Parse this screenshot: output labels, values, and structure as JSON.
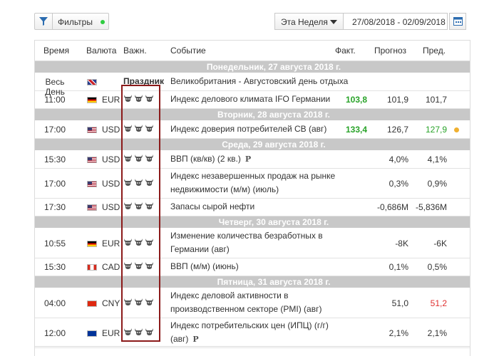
{
  "toolbar": {
    "filter_label": "Фильтры",
    "filter_dot_color": "#2ecc40",
    "week_label": "Эта Неделя",
    "date_range": "27/08/2018 - 02/09/2018"
  },
  "header": {
    "time": "Время",
    "currency": "Валюта",
    "importance": "Важн.",
    "event": "Событие",
    "actual": "Факт.",
    "forecast": "Прогноз",
    "previous": "Пред."
  },
  "days": [
    {
      "title": "Понедельник, 27 августа 2018 г.",
      "rows": [
        {
          "time": "Весь День",
          "flag": "gb",
          "currency": "",
          "importance_text": "Праздник",
          "bulls": 0,
          "event": "Великобритания - Августовский день отдыха",
          "event2": "",
          "actual": "",
          "actual_color": "",
          "forecast": "",
          "previous": "",
          "previous_color": "",
          "dot": "",
          "p": ""
        }
      ]
    },
    {
      "title": "",
      "rows": [
        {
          "time": "11:00",
          "flag": "de",
          "currency": "EUR",
          "importance_text": "",
          "bulls": 3,
          "event": "Индекс делового климата IFO Германии",
          "event2": "",
          "actual": "103,8",
          "actual_color": "green",
          "forecast": "101,9",
          "previous": "101,7",
          "previous_color": "",
          "dot": "",
          "p": ""
        }
      ]
    },
    {
      "title": "Вторник, 28 августа 2018 г.",
      "rows": [
        {
          "time": "17:00",
          "flag": "us",
          "currency": "USD",
          "importance_text": "",
          "bulls": 3,
          "event": "Индекс доверия потребителей CB (авг)",
          "event2": "",
          "actual": "133,4",
          "actual_color": "green",
          "forecast": "126,7",
          "previous": "127,9",
          "previous_color": "green",
          "dot": "#f0b030",
          "p": ""
        }
      ]
    },
    {
      "title": "Среда, 29 августа 2018 г.",
      "rows": [
        {
          "time": "15:30",
          "flag": "us",
          "currency": "USD",
          "importance_text": "",
          "bulls": 3,
          "event": "ВВП (кв/кв) (2 кв.)",
          "event2": "",
          "actual": "",
          "actual_color": "",
          "forecast": "4,0%",
          "previous": "4,1%",
          "previous_color": "",
          "dot": "",
          "p": "P"
        },
        {
          "time": "17:00",
          "flag": "us",
          "currency": "USD",
          "importance_text": "",
          "bulls": 3,
          "event": "Индекс незавершенных продаж на рынке",
          "event2": "недвижимости (м/м) (июль)",
          "actual": "",
          "actual_color": "",
          "forecast": "0,3%",
          "previous": "0,9%",
          "previous_color": "",
          "dot": "",
          "p": ""
        },
        {
          "time": "17:30",
          "flag": "us",
          "currency": "USD",
          "importance_text": "",
          "bulls": 3,
          "event": "Запасы сырой нефти",
          "event2": "",
          "actual": "",
          "actual_color": "",
          "forecast": "-0,686M",
          "previous": "-5,836M",
          "previous_color": "",
          "dot": "",
          "p": ""
        }
      ]
    },
    {
      "title": "Четверг, 30 августа 2018 г.",
      "rows": [
        {
          "time": "10:55",
          "flag": "de",
          "currency": "EUR",
          "importance_text": "",
          "bulls": 3,
          "event": "Изменение количества безработных в",
          "event2": "Германии (авг)",
          "actual": "",
          "actual_color": "",
          "forecast": "-8K",
          "previous": "-6K",
          "previous_color": "",
          "dot": "",
          "p": ""
        },
        {
          "time": "15:30",
          "flag": "ca",
          "currency": "CAD",
          "importance_text": "",
          "bulls": 3,
          "event": "ВВП (м/м) (июнь)",
          "event2": "",
          "actual": "",
          "actual_color": "",
          "forecast": "0,1%",
          "previous": "0,5%",
          "previous_color": "",
          "dot": "",
          "p": ""
        }
      ]
    },
    {
      "title": "Пятница, 31 августа 2018 г.",
      "rows": [
        {
          "time": "04:00",
          "flag": "cn",
          "currency": "CNY",
          "importance_text": "",
          "bulls": 3,
          "event": "Индекс деловой активности в",
          "event2": "производственном секторе (PMI) (авг)",
          "actual": "",
          "actual_color": "",
          "forecast": "51,0",
          "previous": "51,2",
          "previous_color": "red",
          "dot": "",
          "p": ""
        },
        {
          "time": "12:00",
          "flag": "eu",
          "currency": "EUR",
          "importance_text": "",
          "bulls": 3,
          "event": "Индекс потребительских цен (ИПЦ) (г/г)",
          "event2": "(авг)",
          "actual": "",
          "actual_color": "",
          "forecast": "2,1%",
          "previous": "2,1%",
          "previous_color": "",
          "dot": "",
          "p": "P"
        }
      ]
    }
  ],
  "colors": {
    "day_header_bg": "#c8c8c8",
    "highlight_box": "#8b1a1a",
    "positive": "#29a329",
    "negative": "#e03030"
  }
}
